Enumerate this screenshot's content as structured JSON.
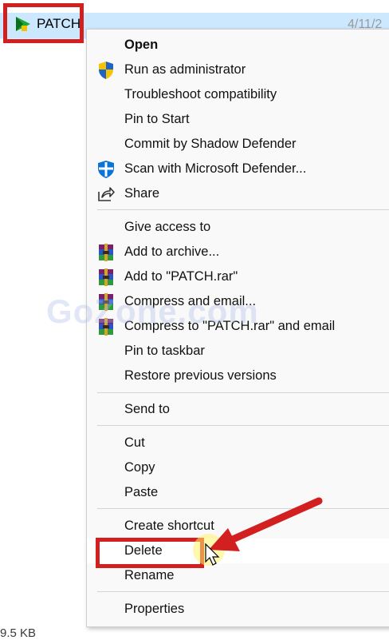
{
  "explorer": {
    "file_name": "PATCH",
    "date_partial": "4/11/2",
    "size_partial": "9.5 KB"
  },
  "watermark": "GoZone.com",
  "menu": {
    "items": [
      {
        "label": "Open",
        "icon": "",
        "bold": true
      },
      {
        "label": "Run as administrator",
        "icon": "uac-shield-icon"
      },
      {
        "label": "Troubleshoot compatibility",
        "icon": ""
      },
      {
        "label": "Pin to Start",
        "icon": ""
      },
      {
        "label": "Commit by Shadow Defender",
        "icon": ""
      },
      {
        "label": "Scan with Microsoft Defender...",
        "icon": "defender-shield-icon"
      },
      {
        "label": "Share",
        "icon": "share-icon"
      },
      {
        "label": "Give access to",
        "icon": "",
        "submenu": true
      },
      {
        "label": "Add to archive...",
        "icon": "winrar-icon"
      },
      {
        "label": "Add to \"PATCH.rar\"",
        "icon": "winrar-icon"
      },
      {
        "label": "Compress and email...",
        "icon": "winrar-icon"
      },
      {
        "label": "Compress to \"PATCH.rar\" and email",
        "icon": "winrar-icon"
      },
      {
        "label": "Pin to taskbar",
        "icon": ""
      },
      {
        "label": "Restore previous versions",
        "icon": ""
      },
      {
        "label": "Send to",
        "icon": "",
        "submenu": true
      },
      {
        "label": "Cut",
        "icon": ""
      },
      {
        "label": "Copy",
        "icon": ""
      },
      {
        "label": "Paste",
        "icon": ""
      },
      {
        "label": "Create shortcut",
        "icon": ""
      },
      {
        "label": "Delete",
        "icon": "",
        "highlighted": true
      },
      {
        "label": "Rename",
        "icon": ""
      },
      {
        "label": "Properties",
        "icon": ""
      }
    ]
  },
  "colors": {
    "annotation_red": "#d21f1f",
    "selection_blue": "#cce8ff",
    "menu_bg": "#f9f9f9"
  }
}
